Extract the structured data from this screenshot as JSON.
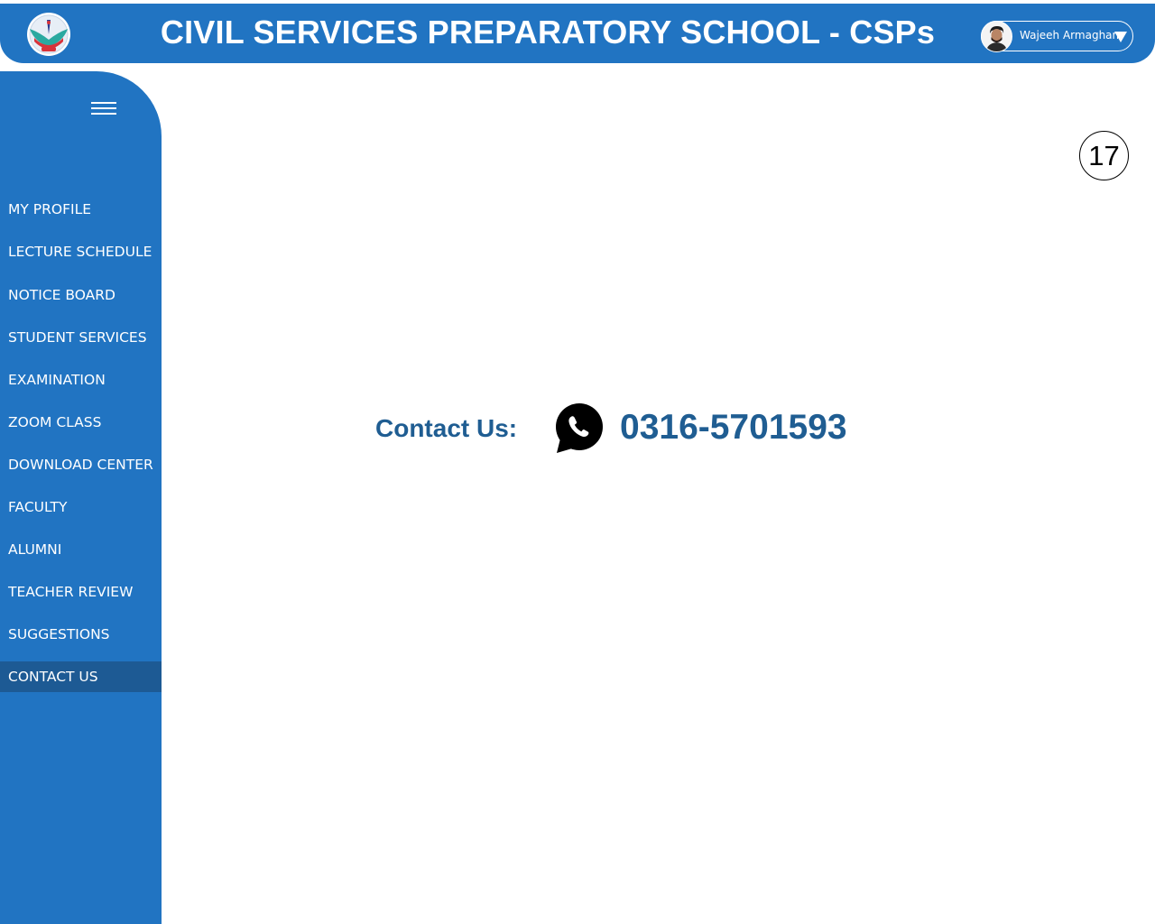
{
  "header": {
    "title": "CIVIL SERVICES PREPARATORY SCHOOL - CSPs",
    "logo_icon": "csps-logo-icon",
    "user": {
      "name": "Wajeeh Armaghan",
      "avatar_icon": "avatar-icon",
      "dropdown_icon": "caret-down-icon"
    }
  },
  "sidebar": {
    "menu_icon": "hamburger-menu-icon",
    "items": [
      {
        "label": "MY PROFILE"
      },
      {
        "label": "LECTURE SCHEDULE"
      },
      {
        "label": "NOTICE BOARD"
      },
      {
        "label": "STUDENT SERVICES"
      },
      {
        "label": "EXAMINATION"
      },
      {
        "label": "ZOOM CLASS"
      },
      {
        "label": "DOWNLOAD CENTER"
      },
      {
        "label": "FACULTY"
      },
      {
        "label": "ALUMNI"
      },
      {
        "label": "TEACHER REVIEW"
      },
      {
        "label": "SUGGESTIONS"
      },
      {
        "label": "CONTACT US"
      }
    ],
    "active_item": "CONTACT US"
  },
  "main": {
    "badge_number": "17",
    "contact_label": "Contact Us:",
    "whatsapp_icon": "whatsapp-icon",
    "phone_number": "0316-5701593"
  },
  "colors": {
    "brand_blue": "#2174c2",
    "active_nav": "#1d5a94",
    "contact_text": "#1f5d92"
  }
}
